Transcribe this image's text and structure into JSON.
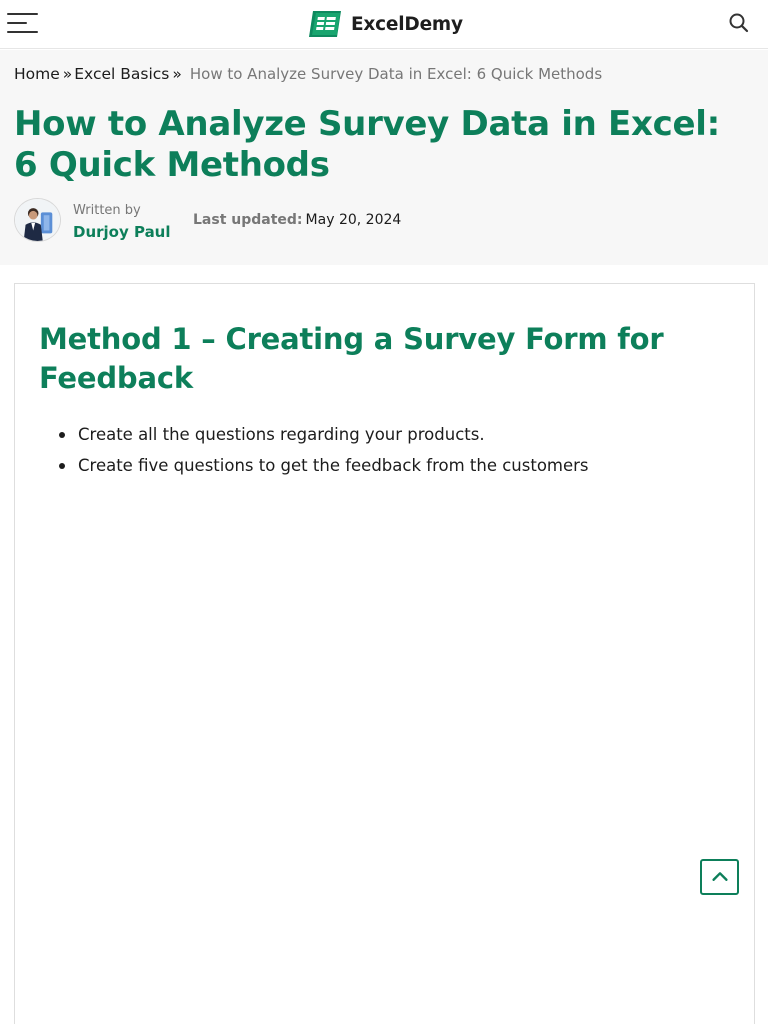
{
  "header": {
    "menu_icon": "hamburger-menu-icon",
    "logo_text": "ExcelDemy",
    "logo_icon": "spreadsheet-logo-icon",
    "search_icon": "search-icon",
    "brand_color": "#0d7f5a"
  },
  "breadcrumb": {
    "items": [
      "Home",
      "Excel Basics"
    ],
    "separator": "»",
    "current": "How to Analyze Survey Data in Excel: 6 Quick Methods"
  },
  "article": {
    "title": "How to Analyze Survey Data in Excel: 6 Quick Methods",
    "written_by_label": "Written by",
    "author": "Durjoy Paul",
    "last_updated_label": "Last updated:",
    "last_updated_date": "May 20, 2024"
  },
  "content": {
    "method_title": "Method 1 – Creating a Survey Form for Feedback",
    "bullets": [
      "Create all the questions regarding your products.",
      "Create five questions to get the feedback from the customers"
    ]
  },
  "back_to_top_icon": "chevron-up-icon"
}
